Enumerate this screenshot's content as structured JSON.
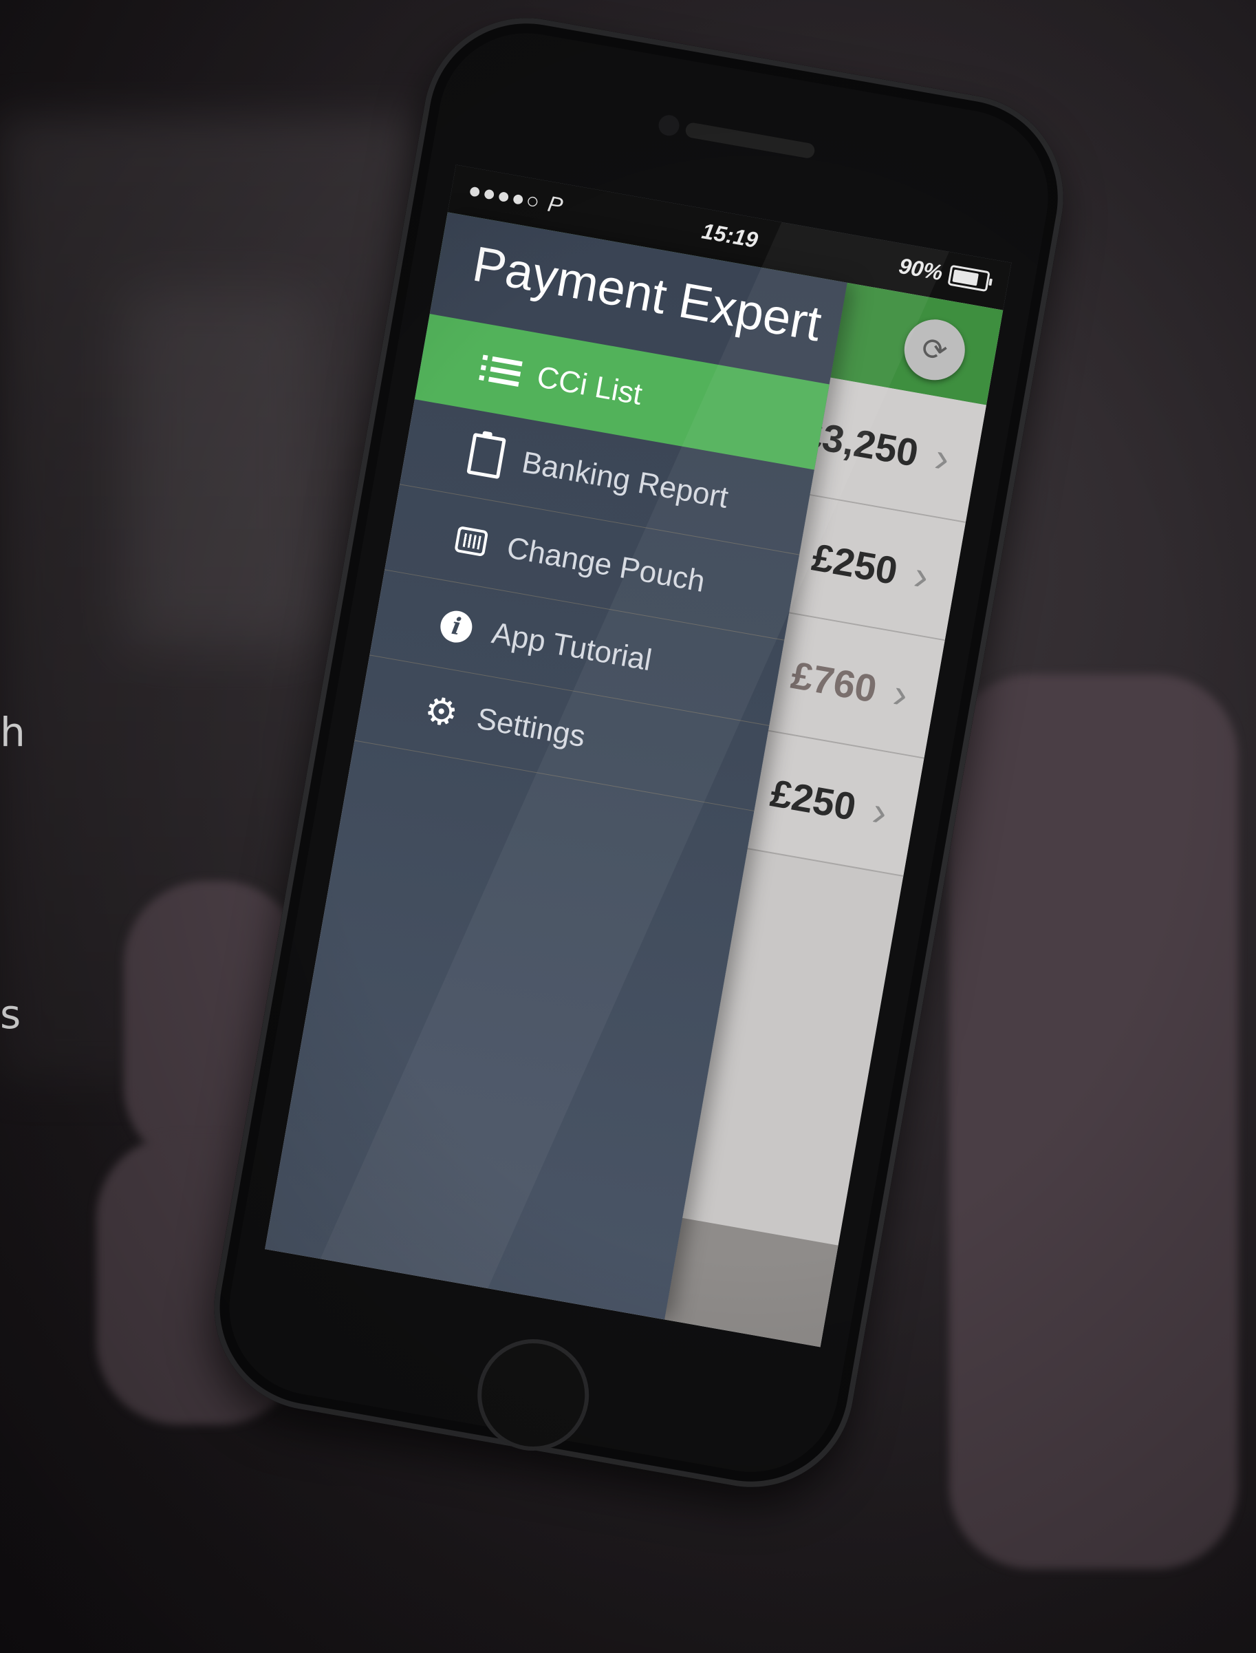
{
  "statusbar": {
    "signal": "●●●●○ P",
    "time": "15:19",
    "battery": "90%"
  },
  "drawer": {
    "title": "Payment Expert",
    "items": [
      {
        "label": "CCi List",
        "icon": "list-icon",
        "active": true
      },
      {
        "label": "Banking Report",
        "icon": "clipboard-icon"
      },
      {
        "label": "Change Pouch",
        "icon": "barcode-icon"
      },
      {
        "label": "App Tutorial",
        "icon": "info-icon"
      },
      {
        "label": "Settings",
        "icon": "gear-icon"
      }
    ]
  },
  "main": {
    "refresh_icon": "refresh-icon",
    "rows": [
      {
        "amount": "£3,250"
      },
      {
        "amount": "£250"
      },
      {
        "amount": "£760"
      },
      {
        "amount": "£250"
      }
    ]
  },
  "background_text": {
    "letter_1": "h",
    "letter_2": "s"
  },
  "colors": {
    "accent_green": "#52b25a",
    "header_green": "#3e8f3f",
    "drawer_bg": "#3f4a5a"
  }
}
